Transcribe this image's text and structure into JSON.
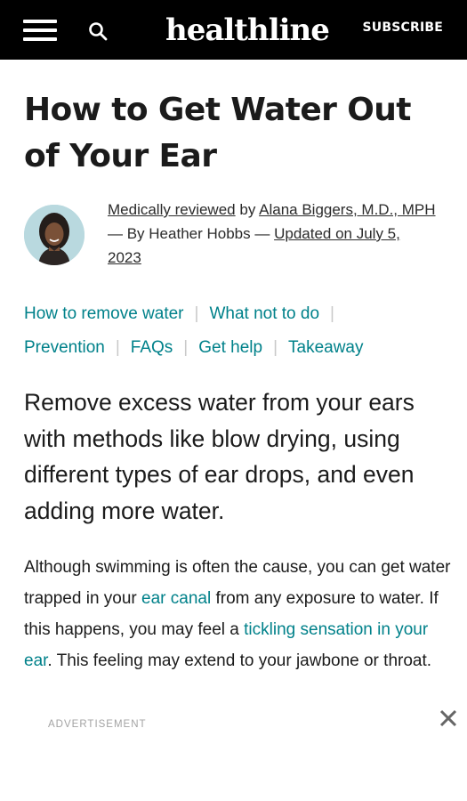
{
  "header": {
    "logo": "healthline",
    "subscribe_label": "SUBSCRIBE",
    "background_color": "#000000"
  },
  "article": {
    "title": "How to Get Water Out of Your Ear",
    "byline": {
      "reviewed_label": "Medically reviewed",
      "by_text": "by",
      "reviewer": "Alana Biggers, M.D., MPH",
      "author_text": "— By Heather Hobbs —",
      "updated_label": "Updated on July 5, 2023"
    },
    "toc": [
      "How to remove water",
      "What not to do",
      "Prevention",
      "FAQs",
      "Get help",
      "Takeaway"
    ],
    "lead": "Remove excess water from your ears with methods like blow drying, using different types of ear drops, and even adding more water.",
    "body": {
      "part1": "Although swimming is often the cause, you can get water trapped in your ",
      "link1": "ear canal",
      "part2": " from any exposure to water. If this happens, you may feel a ",
      "link2": "tickling sensation in your ear",
      "part3": ". This feeling may extend to your jawbone or throat."
    }
  },
  "ad": {
    "label": "ADVERTISEMENT"
  },
  "colors": {
    "link": "#00818a",
    "text": "#1b1b1b"
  }
}
